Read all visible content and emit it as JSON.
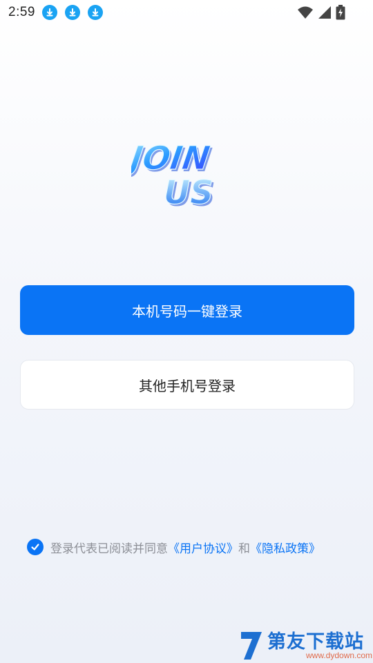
{
  "status_bar": {
    "time": "2:59",
    "notifications": [
      "download-icon",
      "download-icon",
      "download-icon"
    ],
    "right_icons": [
      "wifi-icon",
      "signal-icon",
      "battery-charging-icon"
    ]
  },
  "logo": {
    "line1": "JOIN",
    "line2": "US"
  },
  "buttons": {
    "one_click_login": "本机号码一键登录",
    "other_phone_login": "其他手机号登录"
  },
  "agreement": {
    "checked": true,
    "prefix": "登录代表已阅读并同意",
    "user_agreement": "《用户协议》",
    "conjunction": "和",
    "privacy_policy": "《隐私政策》"
  },
  "watermark": {
    "text": "第友下载站",
    "url": "www.dydown.com"
  },
  "colors": {
    "accent": "#0a74f5",
    "notification": "#1aa3f3",
    "muted_text": "#8c8f96"
  }
}
